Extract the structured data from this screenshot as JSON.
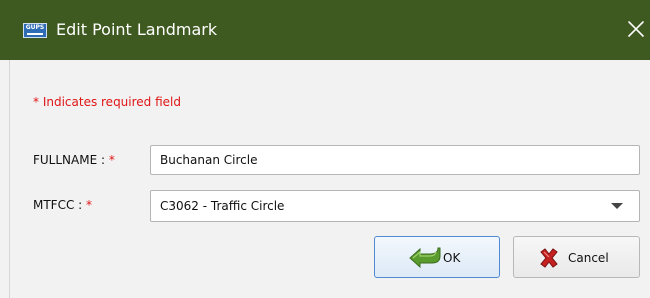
{
  "window": {
    "app_icon_text": "GUPS",
    "title": "Edit Point Landmark",
    "close_icon": "close-icon"
  },
  "form": {
    "required_note": "* Indicates required field",
    "fullname": {
      "label": "FULLNAME : ",
      "required_mark": "*",
      "value": "Buchanan Circle"
    },
    "mtfcc": {
      "label": "MTFCC : ",
      "required_mark": "*",
      "selected": "C3062 - Traffic Circle"
    }
  },
  "buttons": {
    "ok": {
      "label": "OK",
      "icon": "green-arrow-icon"
    },
    "cancel": {
      "label": "Cancel",
      "icon": "red-x-icon"
    }
  },
  "colors": {
    "titlebar": "#3f5a20",
    "required": "#e01515",
    "ok_border": "#4f8ad3"
  }
}
